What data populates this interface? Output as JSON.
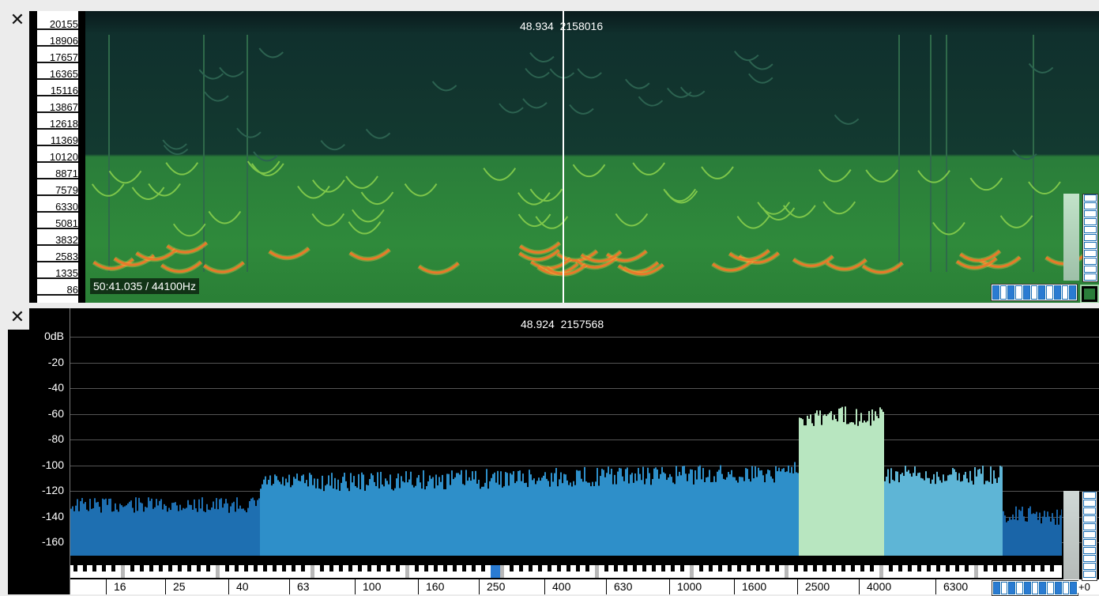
{
  "spectrogram": {
    "close_label": "✕",
    "freq_labels": [
      "20155",
      "18906",
      "17657",
      "16365",
      "15116",
      "13867",
      "12618",
      "11369",
      "10120",
      "8871",
      "7579",
      "6330",
      "5081",
      "3832",
      "2583",
      "1335",
      "86"
    ],
    "cursor_time": "48.934",
    "cursor_sample": "2158016",
    "position": "50:41.035 / 44100Hz"
  },
  "spectrum": {
    "close_label": "✕",
    "cursor_time": "48.924",
    "cursor_sample": "2157568",
    "db_labels": [
      "0dB",
      "-20",
      "-40",
      "-60",
      "-80",
      "-100",
      "-120",
      "-140",
      "-160"
    ],
    "freq_labels": [
      "16",
      "25",
      "40",
      "63",
      "100",
      "160",
      "250",
      "400",
      "630",
      "1000",
      "1600",
      "2500",
      "4000",
      "6300"
    ],
    "gain_label": "+0"
  },
  "colors": {
    "spectrum_blue": "#2e8fc9",
    "spectrum_highlight": "#b8e6c0",
    "spectrogram_green": "#2f8a3b",
    "cursor": "#ffffff"
  }
}
